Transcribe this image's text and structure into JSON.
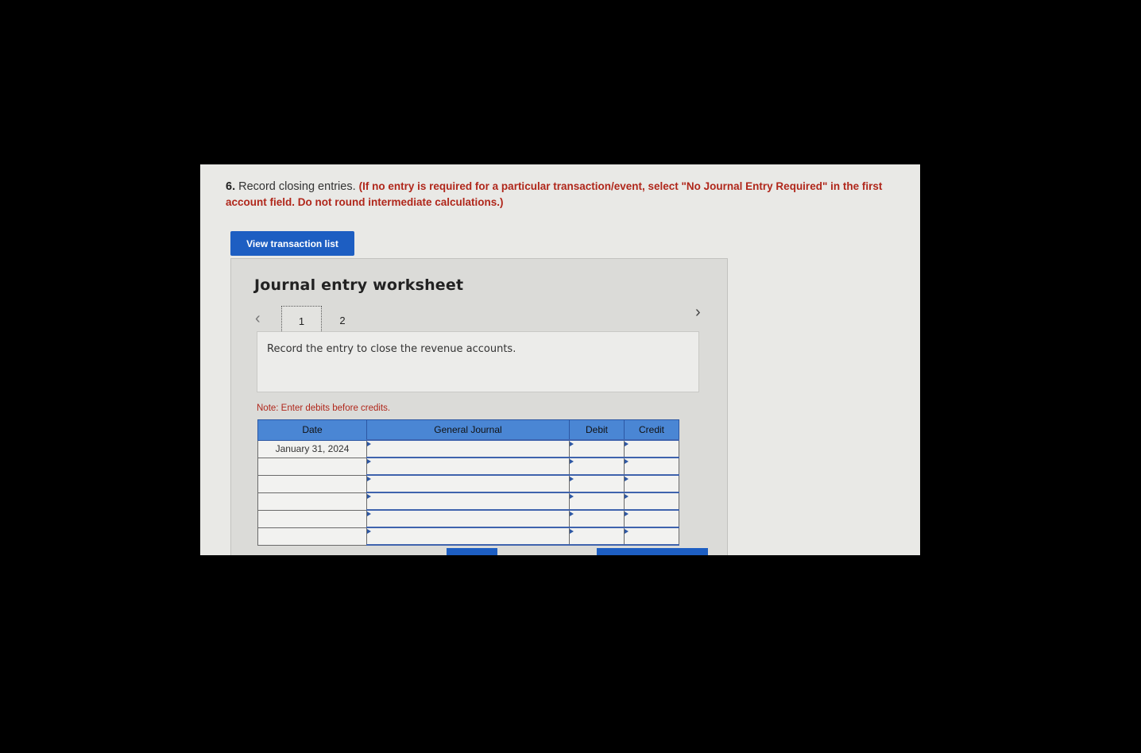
{
  "question": {
    "number": "6.",
    "text": "Record closing entries.",
    "instruction": "(If no entry is required for a particular transaction/event, select \"No Journal Entry Required\" in the first account field. Do not round intermediate calculations.)"
  },
  "view_button_label": "View transaction list",
  "worksheet": {
    "title": "Journal entry worksheet",
    "pages": [
      "1",
      "2"
    ],
    "current_page": "1",
    "prompt": "Record the entry to close the revenue accounts.",
    "note": "Note: Enter debits before credits."
  },
  "table": {
    "headers": [
      "Date",
      "General Journal",
      "Debit",
      "Credit"
    ],
    "rows": [
      {
        "date": "January 31, 2024",
        "account": "",
        "debit": "",
        "credit": ""
      },
      {
        "date": "",
        "account": "",
        "debit": "",
        "credit": ""
      },
      {
        "date": "",
        "account": "",
        "debit": "",
        "credit": ""
      },
      {
        "date": "",
        "account": "",
        "debit": "",
        "credit": ""
      },
      {
        "date": "",
        "account": "",
        "debit": "",
        "credit": ""
      },
      {
        "date": "",
        "account": "",
        "debit": "",
        "credit": ""
      }
    ]
  },
  "icons": {
    "prev": "chevron-left-icon",
    "next": "chevron-right-icon"
  },
  "colors": {
    "accent": "#1d5ec2",
    "instruction": "#b0271b",
    "table_header": "#4a86d4"
  }
}
